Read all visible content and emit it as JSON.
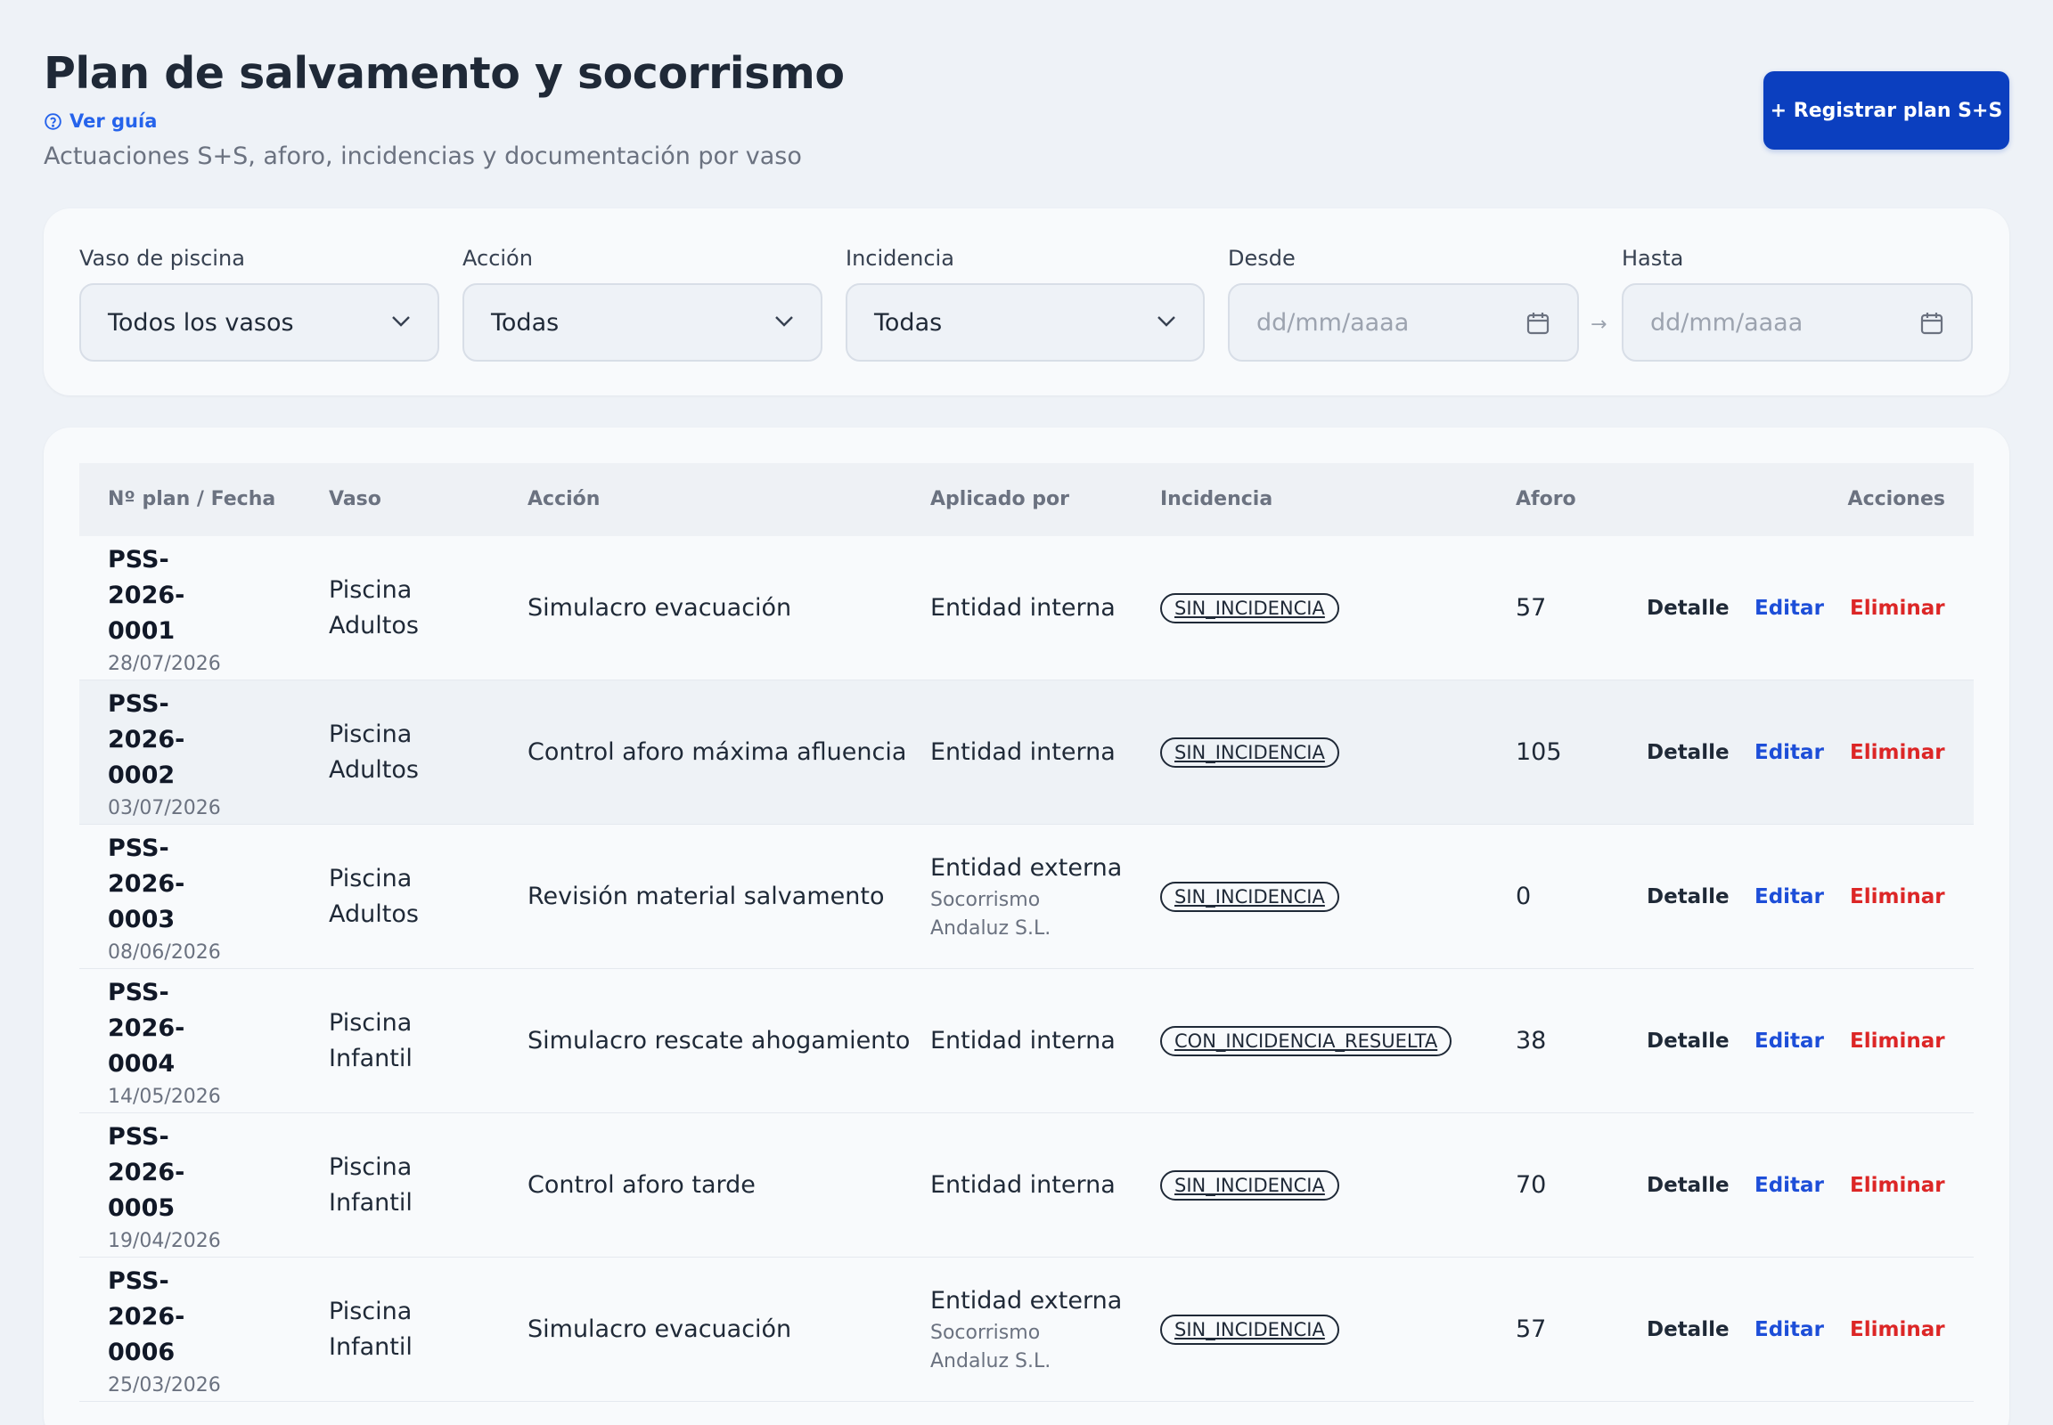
{
  "header": {
    "title": "Plan de salvamento y socorrismo",
    "guide_link": "Ver guía",
    "subtitle": "Actuaciones S+S, aforo, incidencias y documentación por vaso",
    "primary_button": "+ Registrar plan S+S"
  },
  "filters": {
    "vaso": {
      "label": "Vaso de piscina",
      "value": "Todos los vasos"
    },
    "accion": {
      "label": "Acción",
      "value": "Todas"
    },
    "incidencia": {
      "label": "Incidencia",
      "value": "Todas"
    },
    "desde": {
      "label": "Desde",
      "placeholder": "dd/mm/aaaa"
    },
    "hasta": {
      "label": "Hasta",
      "placeholder": "dd/mm/aaaa"
    },
    "range_separator": "→"
  },
  "table": {
    "columns": {
      "plan": "Nº plan / Fecha",
      "vaso": "Vaso",
      "accion": "Acción",
      "aplicado": "Aplicado por",
      "incidencia": "Incidencia",
      "aforo": "Aforo",
      "acciones": "Acciones"
    },
    "action_labels": {
      "detail": "Detalle",
      "edit": "Editar",
      "delete": "Eliminar"
    },
    "rows": [
      {
        "plan": "PSS-2026-0001",
        "date": "28/07/2026",
        "vaso": "Piscina Adultos",
        "accion": "Simulacro evacuación",
        "aplicado": "Entidad interna",
        "aplicado_sub": "",
        "incidencia": "SIN_INCIDENCIA",
        "aforo": "57"
      },
      {
        "plan": "PSS-2026-0002",
        "date": "03/07/2026",
        "vaso": "Piscina Adultos",
        "accion": "Control aforo máxima afluencia",
        "aplicado": "Entidad interna",
        "aplicado_sub": "",
        "incidencia": "SIN_INCIDENCIA",
        "aforo": "105"
      },
      {
        "plan": "PSS-2026-0003",
        "date": "08/06/2026",
        "vaso": "Piscina Adultos",
        "accion": "Revisión material salvamento",
        "aplicado": "Entidad externa",
        "aplicado_sub": "Socorrismo Andaluz S.L.",
        "incidencia": "SIN_INCIDENCIA",
        "aforo": "0"
      },
      {
        "plan": "PSS-2026-0004",
        "date": "14/05/2026",
        "vaso": "Piscina Infantil",
        "accion": "Simulacro rescate ahogamiento",
        "aplicado": "Entidad interna",
        "aplicado_sub": "",
        "incidencia": "CON_INCIDENCIA_RESUELTA",
        "aforo": "38"
      },
      {
        "plan": "PSS-2026-0005",
        "date": "19/04/2026",
        "vaso": "Piscina Infantil",
        "accion": "Control aforo tarde",
        "aplicado": "Entidad interna",
        "aplicado_sub": "",
        "incidencia": "SIN_INCIDENCIA",
        "aforo": "70"
      },
      {
        "plan": "PSS-2026-0006",
        "date": "25/03/2026",
        "vaso": "Piscina Infantil",
        "accion": "Simulacro evacuación",
        "aplicado": "Entidad externa",
        "aplicado_sub": "Socorrismo Andaluz S.L.",
        "incidencia": "SIN_INCIDENCIA",
        "aforo": "57"
      }
    ]
  }
}
